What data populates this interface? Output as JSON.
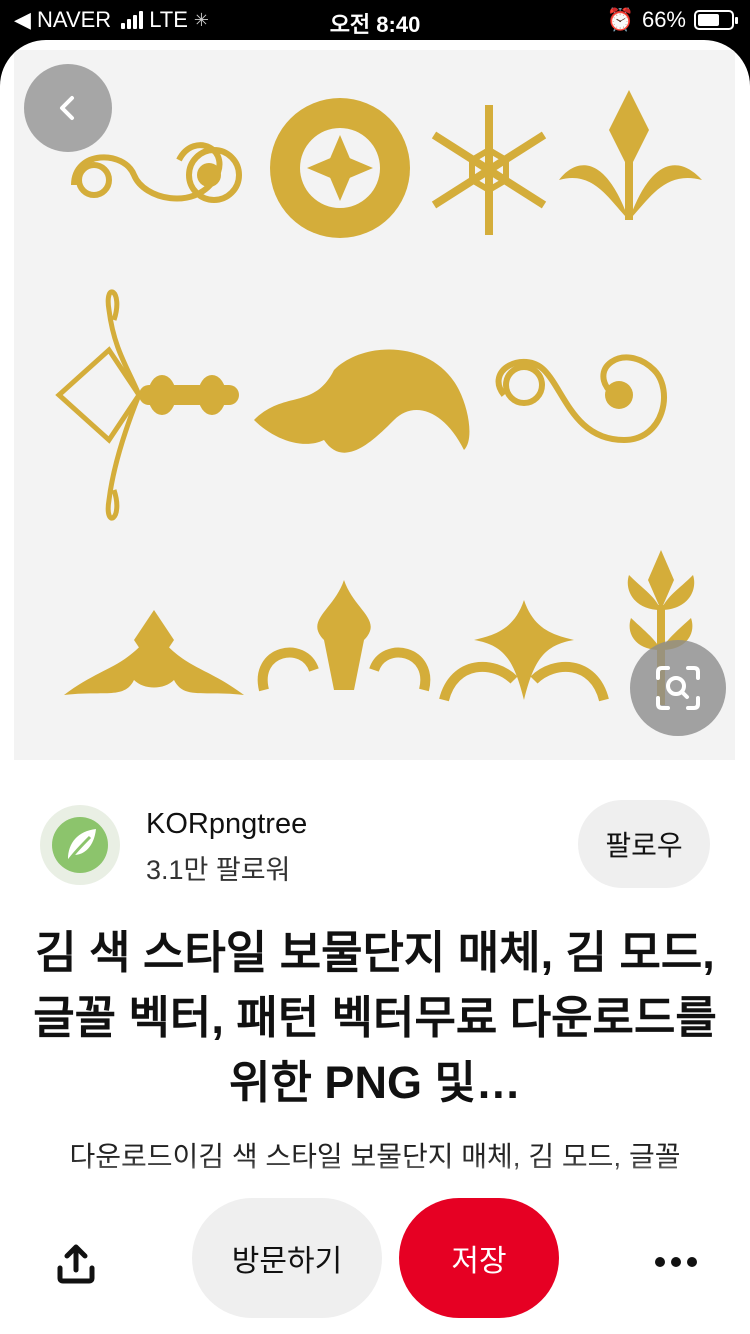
{
  "status_bar": {
    "back_app": "◀ NAVER",
    "network": "LTE",
    "time": "오전 8:40",
    "battery": "66%",
    "battery_level": 0.66
  },
  "pin": {
    "image_icon": "gold-ornaments-image",
    "accent_color": "#d4ad3a"
  },
  "creator": {
    "name": "KORpngtree",
    "followers": "3.1만 팔로워",
    "follow_label": "팔로우"
  },
  "title": "김 색 스타일 보물단지 매체, 김 모드, 글꼴 벡터, 패턴 벡터무료 다운로드를위한 PNG 및…",
  "description": "다운로드이김 색 스타일 보물단지 매체, 김 모드, 글꼴",
  "actions": {
    "visit_label": "방문하기",
    "save_label": "저장",
    "save_color": "#e60023"
  }
}
